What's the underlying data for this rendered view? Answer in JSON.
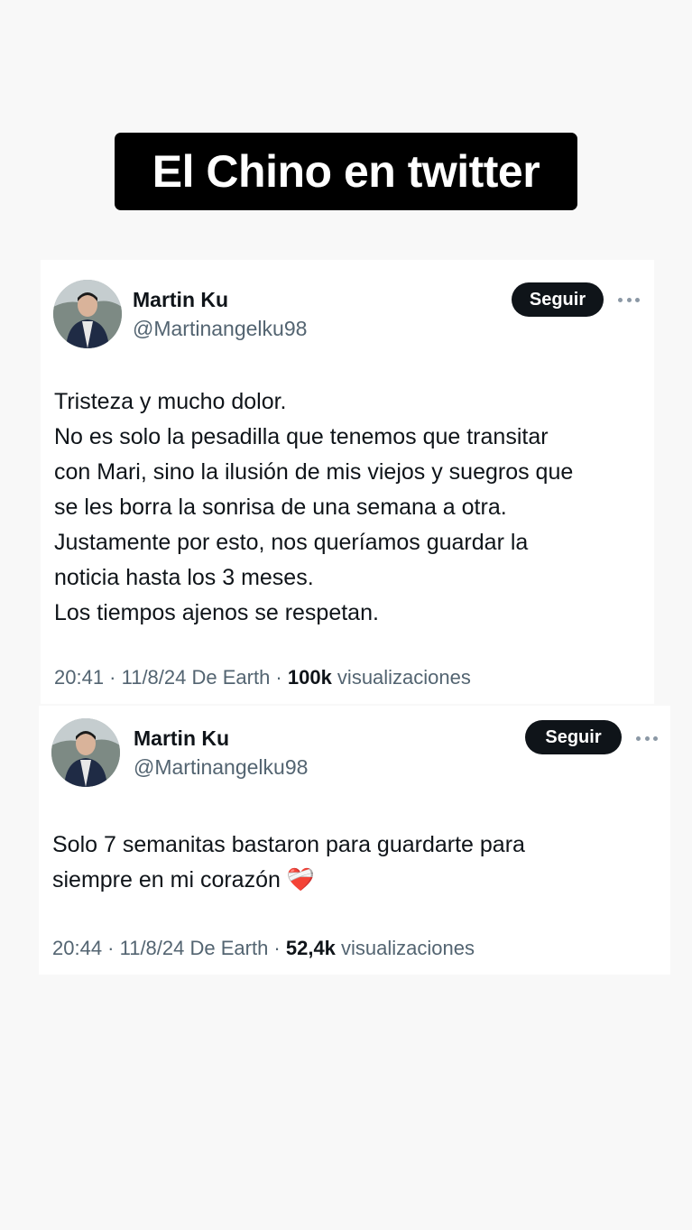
{
  "headline": "El Chino en twitter",
  "tweets": [
    {
      "author_name": "Martin Ku",
      "author_handle": "@Martinangelku98",
      "follow_label": "Seguir",
      "more_icon": "more-horizontal-icon",
      "body_lines": [
        "Tristeza y mucho dolor.",
        "No es solo la pesadilla que tenemos que transitar",
        "con Mari, sino la ilusión de mis viejos y suegros que",
        "se les borra la sonrisa de una semana a otra.",
        "Justamente por esto, nos queríamos guardar la",
        "noticia hasta los 3 meses.",
        "Los tiempos ajenos se respetan."
      ],
      "meta_prefix": "20:41 · 11/8/24 De Earth · ",
      "views_count": "100k",
      "views_label": " visualizaciones"
    },
    {
      "author_name": "Martin Ku",
      "author_handle": "@Martinangelku98",
      "follow_label": "Seguir",
      "more_icon": "more-horizontal-icon",
      "body_lines": [
        "Solo 7 semanitas bastaron para guardarte para",
        "siempre en mi corazón ❤️‍🩹"
      ],
      "meta_prefix": "20:44 · 11/8/24 De Earth · ",
      "views_count": "52,4k",
      "views_label": " visualizaciones"
    }
  ]
}
